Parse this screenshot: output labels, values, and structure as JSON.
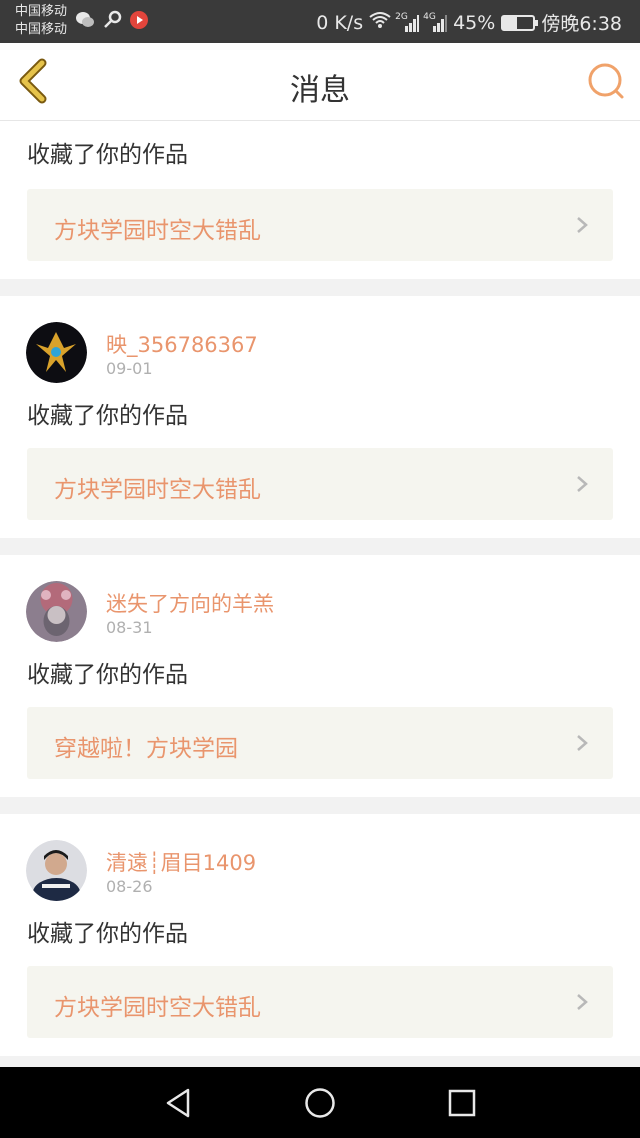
{
  "status_bar": {
    "carrier_1": "中国移动",
    "carrier_2": "中国移动",
    "network_speed": "0 K/s",
    "signal_1_label": "2G",
    "signal_2_label": "4G",
    "battery": "45%",
    "battery_level": 0.45,
    "time": "傍晚6:38"
  },
  "header": {
    "title": "消息",
    "back_icon": "chevron-left-icon",
    "search_icon": "search-icon"
  },
  "colors": {
    "accent": "#e9956d",
    "back_icon": "#c9a227"
  },
  "messages": [
    {
      "action": "收藏了你的作品",
      "work": "方块学园时空大错乱"
    },
    {
      "username": "映_356786367",
      "date": "09-01",
      "action": "收藏了你的作品",
      "work": "方块学园时空大错乱"
    },
    {
      "username": "迷失了方向的羊羔",
      "date": "08-31",
      "action": "收藏了你的作品",
      "work": "穿越啦！方块学园"
    },
    {
      "username": "清遠┊眉目1409",
      "date": "08-26",
      "action": "收藏了你的作品",
      "work": "方块学园时空大错乱"
    }
  ],
  "nav_bar": {
    "back": "triangle-back-icon",
    "home": "circle-home-icon",
    "recents": "square-recents-icon"
  }
}
